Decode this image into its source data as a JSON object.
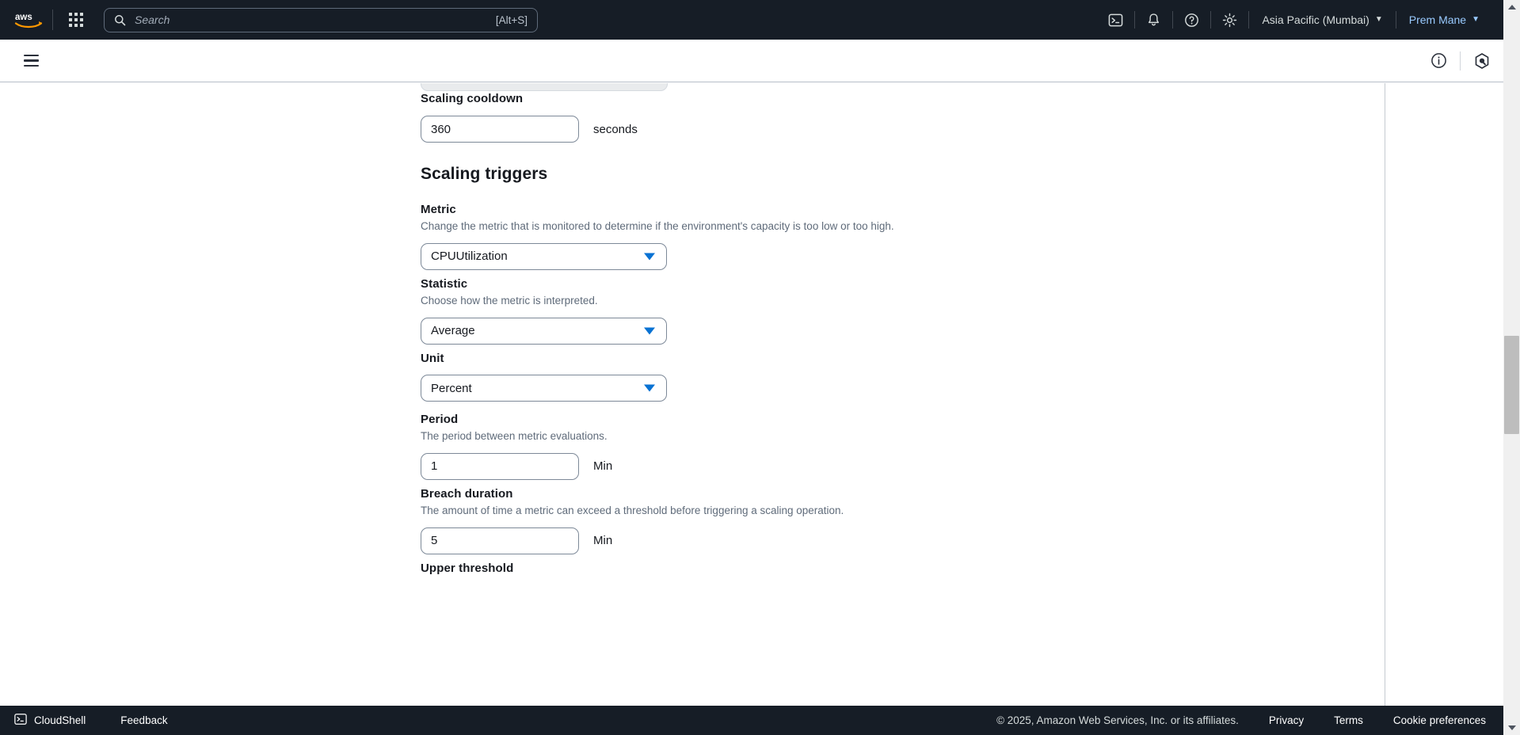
{
  "topnav": {
    "logo_name": "aws-logo",
    "apps_label": "app-launcher",
    "search": {
      "placeholder": "Search",
      "value": "",
      "shortcut": "[Alt+S]"
    },
    "cloudshell_icon": "cloudshell-icon",
    "notifications_icon": "bell-icon",
    "help_icon": "question-circle-icon",
    "settings_icon": "gear-icon",
    "region": "Asia Pacific (Mumbai)",
    "account": "Prem Mane",
    "caret": "▼"
  },
  "secondbar": {
    "menu_icon": "hamburger-menu-icon",
    "info_icon": "info-circle-icon",
    "assistant_icon": "amazon-q-icon"
  },
  "form": {
    "scaling_cooldown": {
      "label": "Scaling cooldown",
      "value": "360",
      "suffix": "seconds"
    },
    "section_title": "Scaling triggers",
    "metric": {
      "label": "Metric",
      "description": "Change the metric that is monitored to determine if the environment's capacity is too low or too high.",
      "value": "CPUUtilization"
    },
    "statistic": {
      "label": "Statistic",
      "description": "Choose how the metric is interpreted.",
      "value": "Average"
    },
    "unit": {
      "label": "Unit",
      "description": "",
      "value": "Percent"
    },
    "period": {
      "label": "Period",
      "description": "The period between metric evaluations.",
      "value": "1",
      "suffix": "Min"
    },
    "breach_duration": {
      "label": "Breach duration",
      "description": "The amount of time a metric can exceed a threshold before triggering a scaling operation.",
      "value": "5",
      "suffix": "Min"
    },
    "upper_threshold": {
      "label": "Upper threshold"
    }
  },
  "footer": {
    "cloudshell": "CloudShell",
    "feedback": "Feedback",
    "copyright": "© 2025, Amazon Web Services, Inc. or its affiliates.",
    "privacy": "Privacy",
    "terms": "Terms",
    "cookies": "Cookie preferences"
  },
  "colors": {
    "nav_background": "#161d26",
    "accent_blue": "#0972d3",
    "link_blue": "#99caff",
    "text_primary": "#16191f",
    "text_secondary": "#5f6b7a"
  }
}
